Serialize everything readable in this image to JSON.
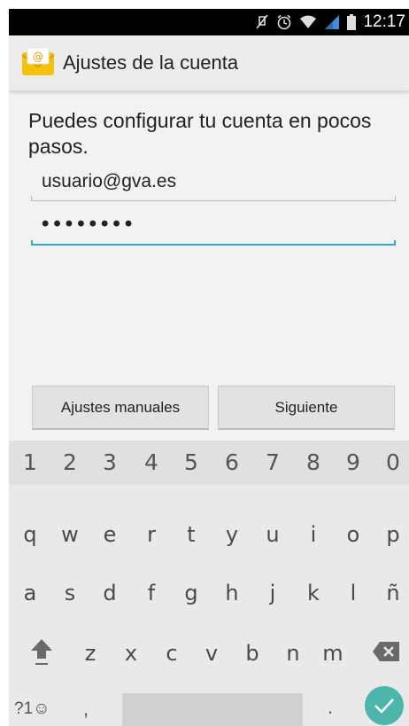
{
  "status_bar": {
    "time": "12:17",
    "icons": [
      "mute-icon",
      "alarm-icon",
      "wifi-icon",
      "signal-icon",
      "battery-icon"
    ]
  },
  "action_bar": {
    "title": "Ajustes de la cuenta",
    "icon": "email-app-icon"
  },
  "form": {
    "prompt": "Puedes configurar tu cuenta en pocos pasos.",
    "email_value": "usuario@gva.es",
    "password_value": "••••••••"
  },
  "buttons": {
    "manual_label": "Ajustes manuales",
    "next_label": "Siguiente"
  },
  "keyboard": {
    "number_row": [
      "1",
      "2",
      "3",
      "4",
      "5",
      "6",
      "7",
      "8",
      "9",
      "0"
    ],
    "row_q": [
      "q",
      "w",
      "e",
      "r",
      "t",
      "y",
      "u",
      "i",
      "o",
      "p"
    ],
    "row_a": [
      "a",
      "s",
      "d",
      "f",
      "g",
      "h",
      "j",
      "k",
      "l",
      "ñ"
    ],
    "row_z": [
      "z",
      "x",
      "c",
      "v",
      "b",
      "n",
      "m"
    ],
    "symbols_label": "?1☺",
    "comma": ",",
    "period": "."
  },
  "colors": {
    "accent": "#33a9cf",
    "enter": "#4db6ac"
  }
}
